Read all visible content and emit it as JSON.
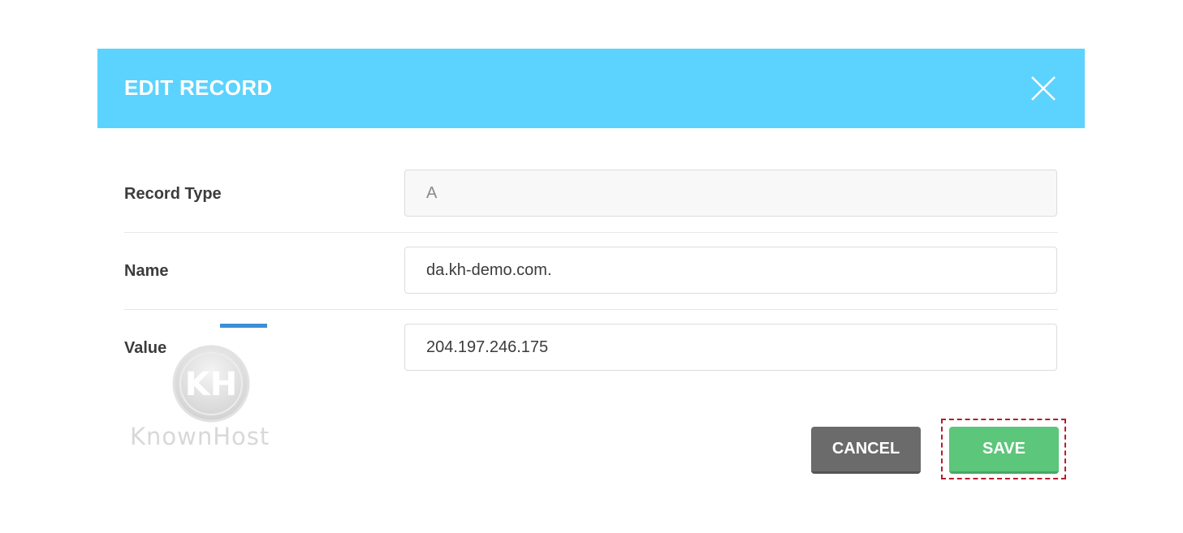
{
  "dialog": {
    "title": "EDIT RECORD",
    "close_icon": "close-icon"
  },
  "fields": {
    "record_type": {
      "label": "Record Type",
      "value": "A"
    },
    "name": {
      "label": "Name",
      "value": "da.kh-demo.com."
    },
    "value": {
      "label": "Value",
      "value": "204.197.246.175"
    }
  },
  "buttons": {
    "cancel_label": "CANCEL",
    "save_label": "SAVE"
  },
  "watermark": {
    "logo_letters": "KH",
    "text": "KnownHost"
  },
  "colors": {
    "header_bg": "#5bd3fe",
    "save_bg": "#5cc67a",
    "cancel_bg": "#6b6b6b",
    "highlight_border": "#b21e2e",
    "accent_line": "#3d8ed8"
  }
}
